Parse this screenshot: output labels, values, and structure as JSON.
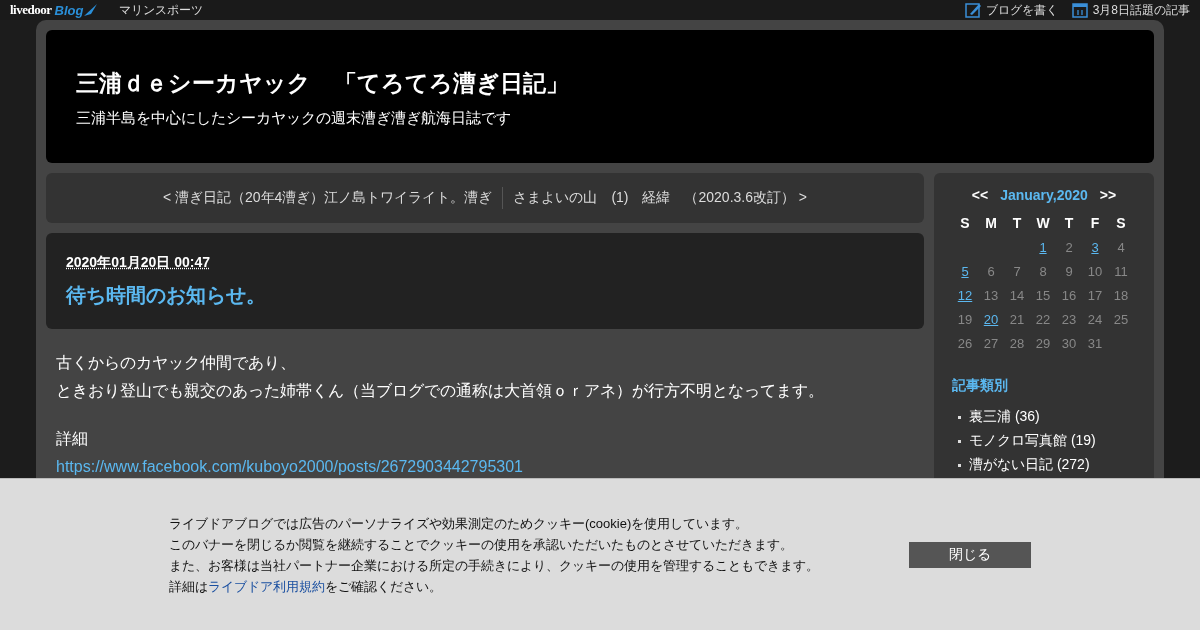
{
  "topbar": {
    "logo": {
      "word": "livedoor",
      "script": "Blog"
    },
    "blog_name": "マリンスポーツ",
    "links": [
      {
        "kind": "write",
        "label": "ブログを書く"
      },
      {
        "kind": "calendar",
        "label": "3月8日話題の記事"
      }
    ]
  },
  "header": {
    "title": "三浦ｄｅシーカヤック　「てろてろ漕ぎ日記」",
    "subtitle": "三浦半島を中心にしたシーカヤックの週末漕ぎ漕ぎ航海日誌です"
  },
  "nav": {
    "prev": "< 漕ぎ日記（20年4漕ぎ）江ノ島トワイライト。漕ぎ",
    "next": "さまよいの山　(1)　経緯　（2020.3.6改訂） >"
  },
  "article": {
    "date": "2020年01月20日 00:47",
    "title": "待ち時間のお知らせ。",
    "paragraphs": [
      {
        "lines": [
          "古くからのカヤック仲間であり、",
          "ときおり登山でも親交のあった姉帯くん（当ブログでの通称は大首領ｏｒアネ）が行方不明となってます。"
        ]
      },
      {
        "lines": [
          "詳細"
        ],
        "link": "https://www.facebook.com/kuboyo2000/posts/2672903442795301"
      }
    ]
  },
  "calendar": {
    "prev": "<<",
    "month": "January,2020",
    "next": ">>",
    "weekdays": [
      "S",
      "M",
      "T",
      "W",
      "T",
      "F",
      "S"
    ],
    "weeks": [
      {
        "kind": "first",
        "days": [
          {
            "day": "1",
            "linked": true
          },
          {
            "day": "2",
            "linked": false
          },
          {
            "day": "3",
            "linked": true
          },
          {
            "day": "4",
            "linked": false
          }
        ]
      },
      {
        "kind": "full",
        "days": [
          {
            "day": "5",
            "linked": true
          },
          {
            "day": "6",
            "linked": false
          },
          {
            "day": "7",
            "linked": false
          },
          {
            "day": "8",
            "linked": false
          },
          {
            "day": "9",
            "linked": false
          },
          {
            "day": "10",
            "linked": false
          },
          {
            "day": "11",
            "linked": false
          }
        ]
      },
      {
        "kind": "full",
        "days": [
          {
            "day": "12",
            "linked": true
          },
          {
            "day": "13",
            "linked": false
          },
          {
            "day": "14",
            "linked": false
          },
          {
            "day": "15",
            "linked": false
          },
          {
            "day": "16",
            "linked": false
          },
          {
            "day": "17",
            "linked": false
          },
          {
            "day": "18",
            "linked": false
          }
        ]
      },
      {
        "kind": "full",
        "days": [
          {
            "day": "19",
            "linked": false
          },
          {
            "day": "20",
            "linked": true
          },
          {
            "day": "21",
            "linked": false
          },
          {
            "day": "22",
            "linked": false
          },
          {
            "day": "23",
            "linked": false
          },
          {
            "day": "24",
            "linked": false
          },
          {
            "day": "25",
            "linked": false
          }
        ]
      },
      {
        "kind": "last",
        "days": [
          {
            "day": "26",
            "linked": false
          },
          {
            "day": "27",
            "linked": false
          },
          {
            "day": "28",
            "linked": false
          },
          {
            "day": "29",
            "linked": false
          },
          {
            "day": "30",
            "linked": false
          },
          {
            "day": "31",
            "linked": false
          }
        ]
      }
    ]
  },
  "categories": {
    "title": "記事類別",
    "items": [
      "裏三浦 (36)",
      "モノクロ写真館 (19)",
      "漕がない日記 (272)"
    ]
  },
  "cookie_banner": {
    "lines": [
      "ライブドアブログでは広告のパーソナライズや効果測定のためクッキー(cookie)を使用しています。",
      "このバナーを閉じるか閲覧を継続することでクッキーの使用を承認いただいたものとさせていただきます。",
      "また、お客様は当社パートナー企業における所定の手続きにより、クッキーの使用を管理することもできます。"
    ],
    "last_line": {
      "before": "詳細は",
      "link": "ライブドア利用規約",
      "after": "をご確認ください。"
    },
    "button": "閉じる"
  }
}
